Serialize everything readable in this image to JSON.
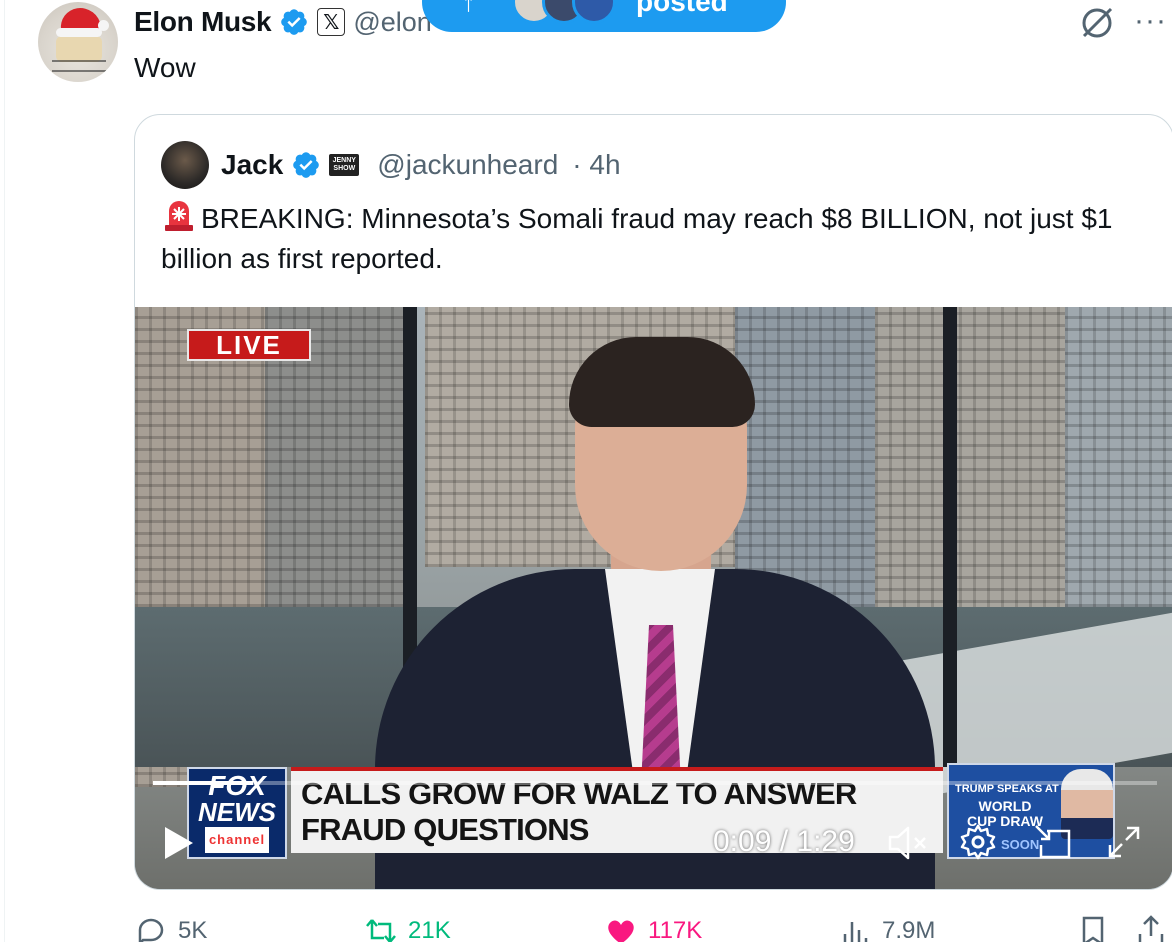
{
  "post": {
    "author_name": "Elon Musk",
    "author_handle": "@elon",
    "text": "Wow",
    "verified": true,
    "affiliate_badge_icon": "x-logo-icon"
  },
  "posted_pill": {
    "label": "posted",
    "arrow_icon": "arrow-up-icon"
  },
  "quote": {
    "author_name": "Jack",
    "author_handle": "@jackunheard",
    "time": "· 4h",
    "badge_text": "JENNY SHOW",
    "text_icon": "siren-icon",
    "text": "BREAKING: Minnesota’s Somali fraud may reach $8 BILLION, not just $1 billion as first reported."
  },
  "video": {
    "live_label": "LIVE",
    "network_logo": {
      "line1": "FOX",
      "line2": "NEWS",
      "line3": "channel"
    },
    "headline": "CALLS GROW FOR WALZ TO ANSWER FRAUD QUESTIONS",
    "promo": {
      "line1": "TRUMP SPEAKS AT",
      "line2": "WORLD CUP DRAW",
      "line3": "SOON"
    },
    "time_display": "0:09 / 1:29",
    "progress_fraction": 0.1
  },
  "actions": {
    "replies": "5K",
    "reposts": "21K",
    "likes": "117K",
    "views": "7.9M"
  },
  "colors": {
    "accent": "#1d9bf0",
    "like": "#f91880",
    "repost": "#00ba7c",
    "muted_text": "#536471",
    "live_red": "#c61b1b"
  }
}
